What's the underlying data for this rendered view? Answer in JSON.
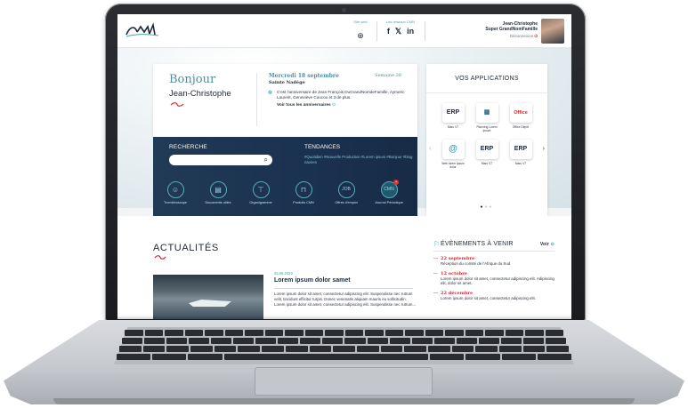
{
  "header": {
    "site_web_label": "Site web",
    "reseaux_label": "Les réseaux CMN",
    "social": [
      "f",
      "𝕏",
      "in"
    ],
    "user_name": "Jean-Christophe",
    "user_role": "Super GrandNomFamille",
    "logout_label": "Déconnexion"
  },
  "greeting": {
    "hello": "Bonjour",
    "name": "Jean-Christophe",
    "date": "Mercredi 18 septembre",
    "week": "Semaine 38",
    "saint": "Sainte Nadège",
    "anniversary": "C'est l'anniversaire de Jean François DuGrandNomdeFamille, Aymeric Laurent, Geneviève Coucou et 3 de plus.",
    "anniversary_link": "Voir tous les anniversaires"
  },
  "search": {
    "title": "RECHERCHE",
    "placeholder": ""
  },
  "trends": {
    "title": "TENDANCES",
    "tags": "#Quotidien #Nouvelle Production #Lorem ipsum #Bonjour #blog navires"
  },
  "shortcuts": [
    {
      "label": "Trombinoscope",
      "icon": "person-icon"
    },
    {
      "label": "Documents utiles",
      "icon": "document-icon"
    },
    {
      "label": "Organigramme",
      "icon": "org-chart-icon"
    },
    {
      "label": "Produits CMN",
      "icon": "shirt-icon"
    },
    {
      "label": "Offres d'emploi",
      "icon": "job-icon"
    },
    {
      "label": "Journal Périodique",
      "icon": "journal-icon"
    }
  ],
  "apps": {
    "title": "VOS APPLICATIONS",
    "items": [
      {
        "tile": "ERP",
        "label": "Marc V7"
      },
      {
        "tile": "▦",
        "label": "Planning Lorem ipsum"
      },
      {
        "tile": "Office",
        "label": "Office Dépôt"
      },
      {
        "tile": "@",
        "label": "Web lorem ipsum dolor"
      },
      {
        "tile": "ERP",
        "label": "Marc V7"
      },
      {
        "tile": "ERP",
        "label": "Marc V7"
      }
    ]
  },
  "news": {
    "section_title": "ACTUALITÉS",
    "date": "25.08.2022",
    "title": "Lorem ipsum dolor samet",
    "body": "Lorem ipsum dolor sit amet, consectetur adipiscing elit. Suspendisse nec rutrum velit, tincidunt efficitur turpis. Donec venenatis aliquam mauris eu sollicitudin. Lorem ipsum dolor sit amet, consectetur adipiscing elit. Suspendisse nec rutrum..."
  },
  "events": {
    "title": "ÉVÈNEMENTS À VENIR",
    "see_all": "Voir",
    "items": [
      {
        "date": "22 septembre",
        "text": "Réception du comité de l'Afrique du Sud"
      },
      {
        "date": "12 octobre",
        "text": "Lorem ipsum dolor sit amet, consectetur adipiscing elit. Adipiscing elit, dolor sit amet."
      },
      {
        "date": "22 décembre",
        "text": "Lorem ipsum dolor sit amet, consectetur adipiscing elit."
      }
    ]
  }
}
